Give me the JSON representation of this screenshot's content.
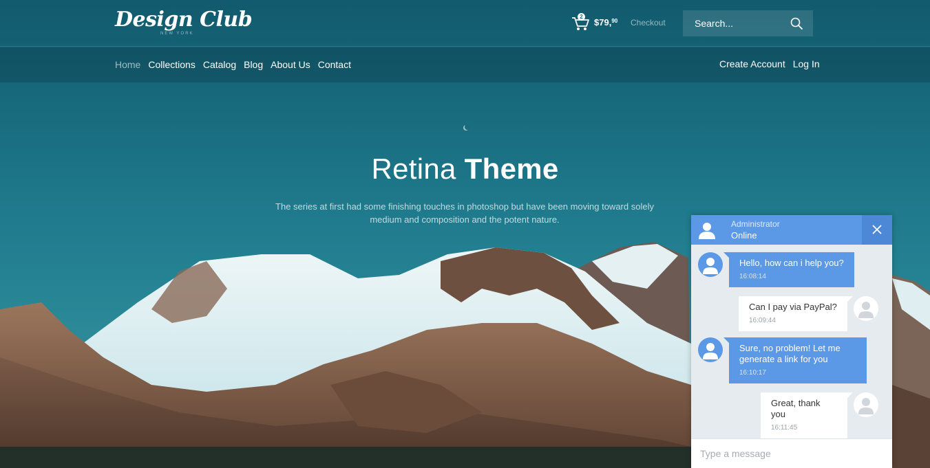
{
  "header": {
    "logo_text": "Design Club",
    "logo_subtext": "NEW YORK",
    "cart_count": "2",
    "cart_total_main": "$79,",
    "cart_total_cents": "90",
    "checkout_label": "Checkout",
    "search_placeholder": "Search..."
  },
  "nav": {
    "items": [
      {
        "label": "Home",
        "active": true
      },
      {
        "label": "Collections"
      },
      {
        "label": "Catalog"
      },
      {
        "label": "Blog"
      },
      {
        "label": "About Us"
      },
      {
        "label": "Contact"
      }
    ],
    "create_account": "Create Account",
    "login": "Log In"
  },
  "hero": {
    "title_light": "Retina",
    "title_bold": "Theme",
    "subtitle": "The series at first had some finishing touches in photoshop but have been moving toward solely medium and composition and the potent nature."
  },
  "chat": {
    "admin_name": "Administrator",
    "admin_status": "Online",
    "messages": [
      {
        "from": "admin",
        "text": "Hello, how can i help you?",
        "time": "16:08:14"
      },
      {
        "from": "user",
        "text": "Can I pay via PayPal?",
        "time": "16:09:44"
      },
      {
        "from": "admin",
        "text": "Sure, no problem! Let me generate a link for you",
        "time": "16:10:17"
      },
      {
        "from": "user",
        "text": "Great, thank you",
        "time": "16:11:45"
      }
    ],
    "input_placeholder": "Type a message"
  },
  "colors": {
    "sky_top": "#135f72",
    "sky_bottom": "#2a8a98",
    "chat_blue": "#5b98e6",
    "chat_panel": "#e6ebf0"
  }
}
